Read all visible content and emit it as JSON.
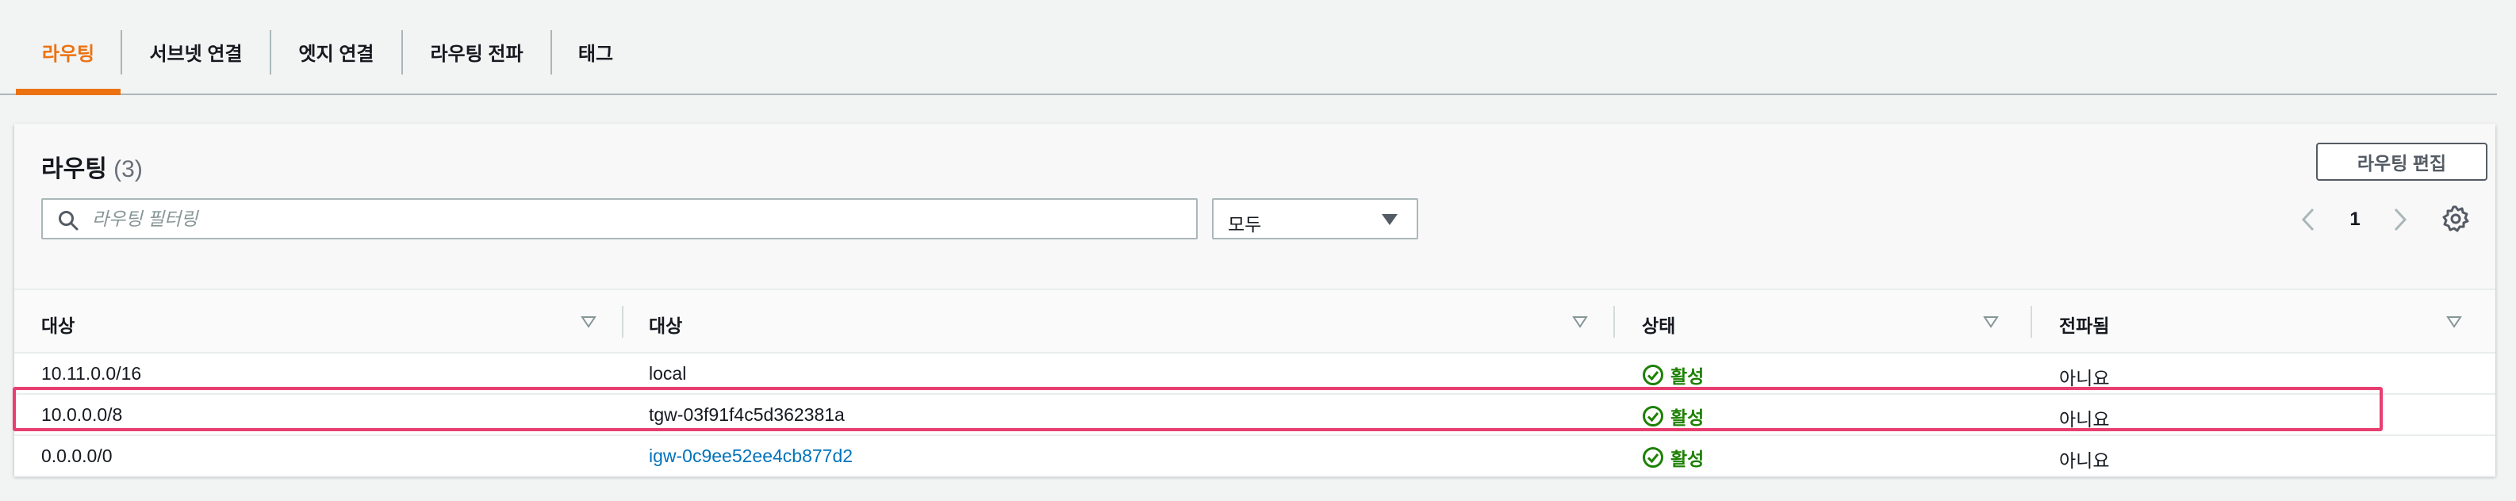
{
  "tabs": [
    {
      "label": "라우팅",
      "active": true
    },
    {
      "label": "서브넷 연결",
      "active": false
    },
    {
      "label": "엣지 연결",
      "active": false
    },
    {
      "label": "라우팅 전파",
      "active": false
    },
    {
      "label": "태그",
      "active": false
    }
  ],
  "panel": {
    "title": "라우팅",
    "count": "(3)",
    "edit_button": "라우팅 편집",
    "search_placeholder": "라우팅 필터링",
    "filter_select": "모두",
    "page_number": "1"
  },
  "table": {
    "columns": [
      "대상",
      "대상",
      "상태",
      "전파됨"
    ],
    "rows": [
      {
        "destination": "10.11.0.0/16",
        "target": "local",
        "target_link": false,
        "status": "활성",
        "propagated": "아니요"
      },
      {
        "destination": "10.0.0.0/8",
        "target": "tgw-03f91f4c5d362381a",
        "target_link": false,
        "status": "활성",
        "propagated": "아니요"
      },
      {
        "destination": "0.0.0.0/0",
        "target": "igw-0c9ee52ee4cb877d2",
        "target_link": true,
        "status": "활성",
        "propagated": "아니요"
      }
    ]
  },
  "colors": {
    "accent": "#ec7211",
    "success": "#1d8102",
    "link": "#0073bb",
    "highlight": "#e83e70"
  },
  "icons": {
    "search": "search-icon",
    "caret": "caret-down-icon",
    "prev": "chevron-left-icon",
    "next": "chevron-right-icon",
    "settings": "gear-icon",
    "sort": "sort-triangle-icon",
    "status": "check-circle-icon"
  }
}
